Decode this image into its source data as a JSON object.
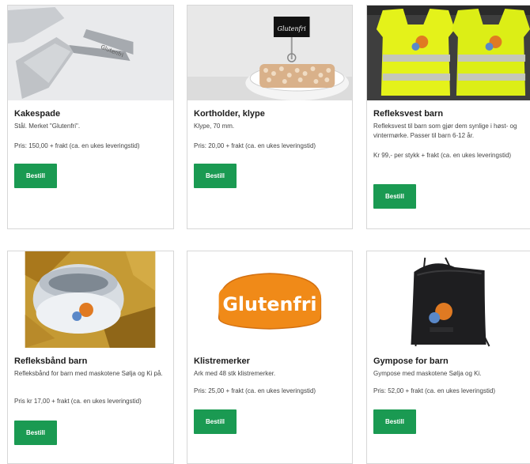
{
  "products": [
    {
      "title": "Kakespade",
      "description": "Stål. Merket \"Glutenfri\".",
      "price": "Pris: 150,00 + frakt (ca. en ukes leveringstid)",
      "button": "Bestill",
      "image_icon": "cake-server-image"
    },
    {
      "title": "Kortholder, klype",
      "description": "Klype, 70 mm.",
      "price": "Pris: 20,00 + frakt (ca. en ukes leveringstid)",
      "button": "Bestill",
      "image_icon": "card-holder-image",
      "image_text": "Glutenfri"
    },
    {
      "title": "Refleksvest barn",
      "description": "Refleksvest til barn som gjør dem synlige i høst- og vintermørke. Passer til barn 6-12 år.",
      "price": "Kr 99,- per stykk + frakt (ca. en ukes leveringstid)",
      "button": "Bestill",
      "image_icon": "reflective-vest-image"
    },
    {
      "title": "Refleksbånd barn",
      "description": "Refleksbånd for barn med maskotene Sølja og Ki på.",
      "price": "Pris kr 17,00 + frakt (ca. en ukes leveringstid)",
      "button": "Bestill",
      "image_icon": "reflective-band-image"
    },
    {
      "title": "Klistremerker",
      "description": "Ark med 48 stk klistremerker.",
      "price": "Pris: 25,00 + frakt (ca. en ukes leveringstid)",
      "button": "Bestill",
      "image_icon": "sticker-image",
      "image_text": "Glutenfri"
    },
    {
      "title": "Gympose for barn",
      "description": "Gympose med maskotene Sølja og Ki.",
      "price": "Pris: 52,00 + frakt (ca. en ukes leveringstid)",
      "button": "Bestill",
      "image_icon": "gym-bag-image"
    }
  ],
  "colors": {
    "button": "#1a9a52",
    "vest": "#e4f21a",
    "sticker_orange": "#f08a18"
  }
}
